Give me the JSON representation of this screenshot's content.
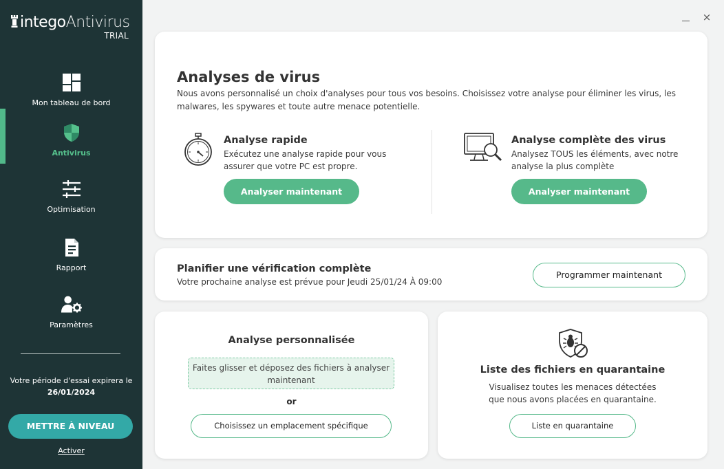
{
  "app": {
    "brand_name": "intego",
    "brand_product": "Antivirus",
    "edition": "TRIAL"
  },
  "sidebar": {
    "items": [
      {
        "label": "Mon tableau de bord",
        "icon": "dashboard-icon"
      },
      {
        "label": "Antivirus",
        "icon": "shield-icon",
        "active": true
      },
      {
        "label": "Optimisation",
        "icon": "sliders-icon"
      },
      {
        "label": "Rapport",
        "icon": "report-icon"
      },
      {
        "label": "Paramètres",
        "icon": "user-settings-icon"
      }
    ],
    "trial_text": "Votre période d'essai expirera le",
    "trial_date": "26/01/2024",
    "upgrade_label": "METTRE À NIVEAU",
    "activate_label": "Activer"
  },
  "window": {
    "minimize": "minimize-icon",
    "close": "×"
  },
  "main": {
    "title": "Analyses de virus",
    "description": "Nous avons personnalisé un choix d'analyses pour tous vos besoins. Choisissez votre analyse pour éliminer les virus, les malwares, les spywares et toute autre menace potentielle.",
    "quick_scan": {
      "title": "Analyse rapide",
      "description": "Exécutez une analyse rapide pour vous assurer que votre PC est propre.",
      "button": "Analyser maintenant",
      "icon": "stopwatch-icon"
    },
    "full_scan": {
      "title": "Analyse complète des virus",
      "description": "Analysez TOUS les éléments, avec notre analyse la plus complète",
      "button": "Analyser maintenant",
      "icon": "computer-magnifier-icon"
    }
  },
  "schedule": {
    "title": "Planifier une vérification complète",
    "subtitle": "Votre prochaine analyse est prévue pour Jeudi 25/01/24 À 09:00",
    "button": "Programmer maintenant"
  },
  "custom_scan": {
    "title": "Analyse personnalisée",
    "drop_text": "Faites glisser et déposez des fichiers à analyser maintenant",
    "or": "or",
    "button": "Choisissez un emplacement spécifique"
  },
  "quarantine": {
    "title": "Liste des fichiers en quarantaine",
    "description": "Visualisez toutes les menaces détectées que nous avons placées en quarantaine.",
    "button": "Liste en quarantaine",
    "icon": "quarantine-shield-icon"
  },
  "colors": {
    "sidebar_bg": "#1e3436",
    "accent_green": "#56b98a",
    "upgrade_teal": "#33a9a7",
    "active_label": "#55c08c"
  }
}
